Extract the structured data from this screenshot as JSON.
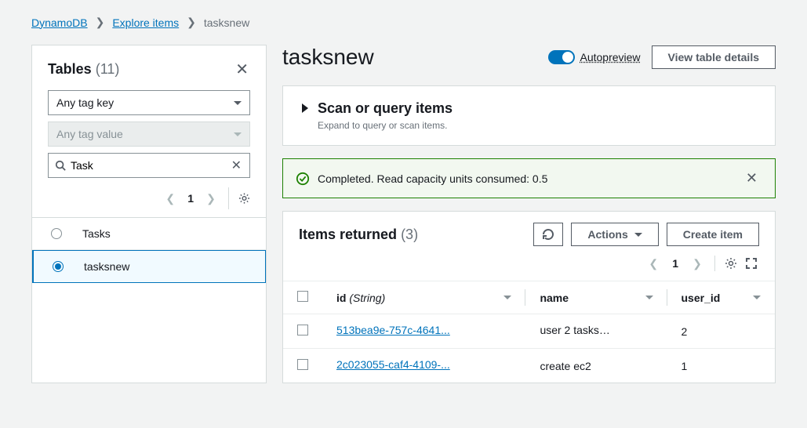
{
  "breadcrumb": {
    "service": "DynamoDB",
    "section": "Explore items",
    "current": "tasksnew"
  },
  "sidebar": {
    "title": "Tables",
    "count": "(11)",
    "tag_key_label": "Any tag key",
    "tag_value_label": "Any tag value",
    "search_value": "Task",
    "page": "1",
    "items": [
      {
        "label": "Tasks",
        "selected": false
      },
      {
        "label": "tasksnew",
        "selected": true
      }
    ]
  },
  "main": {
    "title": "tasksnew",
    "autopreview_label": "Autopreview",
    "view_details_label": "View table details",
    "scan_query": {
      "title": "Scan or query items",
      "subtitle": "Expand to query or scan items."
    },
    "alert": "Completed. Read capacity units consumed: 0.5",
    "items": {
      "title": "Items returned",
      "count": "(3)",
      "actions_label": "Actions",
      "create_label": "Create item",
      "page": "1",
      "columns": {
        "id": {
          "label": "id",
          "type": "(String)"
        },
        "name": {
          "label": "name"
        },
        "user_id": {
          "label": "user_id"
        }
      },
      "rows": [
        {
          "id": "513bea9e-757c-4641...",
          "name": "user 2 tasks…",
          "user_id": "2"
        },
        {
          "id": "2c023055-caf4-4109-...",
          "name": "create ec2",
          "user_id": "1"
        }
      ]
    }
  }
}
